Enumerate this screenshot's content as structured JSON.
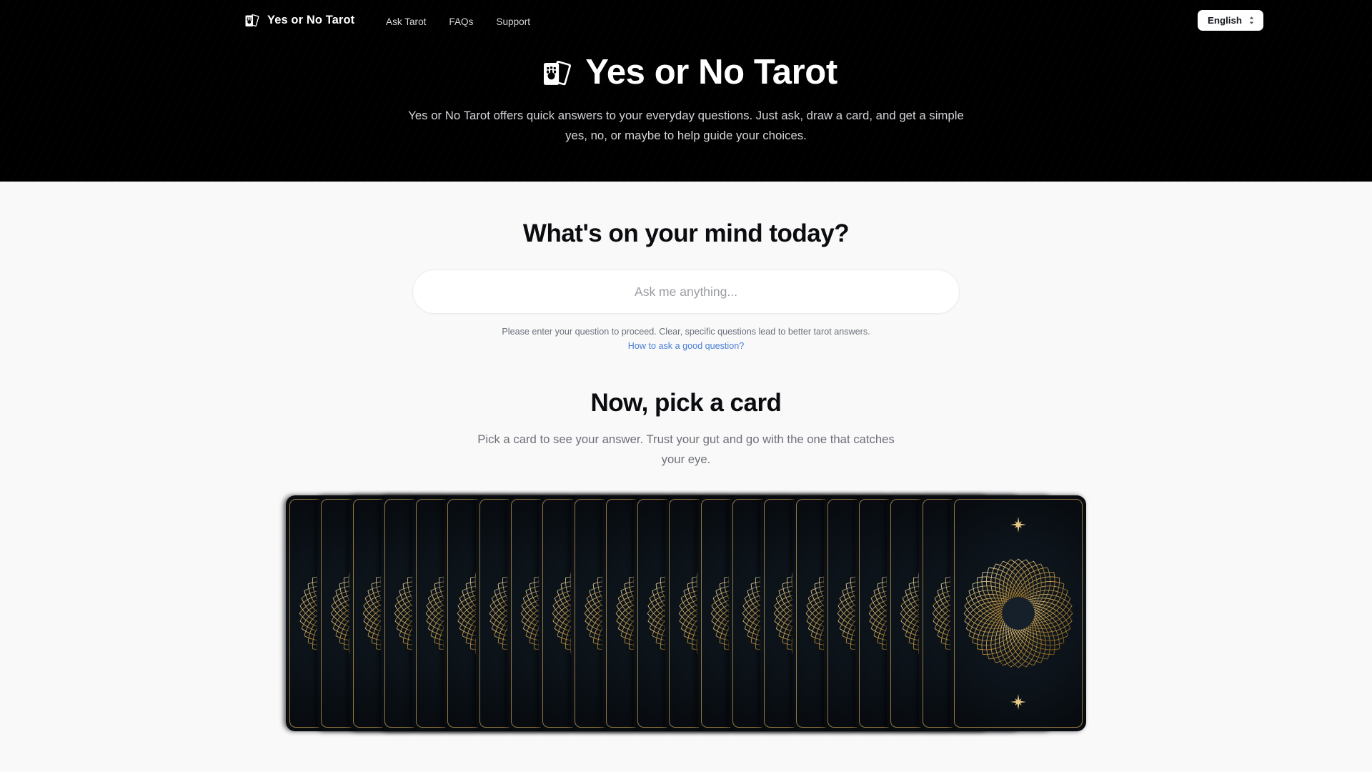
{
  "brand": {
    "name": "Yes or No Tarot",
    "logo_icon": "tarot-cards-icon"
  },
  "nav": {
    "links": [
      {
        "label": "Ask Tarot"
      },
      {
        "label": "FAQs"
      },
      {
        "label": "Support"
      }
    ],
    "language": {
      "selected": "English",
      "icon": "chevron-up-down-icon"
    }
  },
  "hero": {
    "title": "Yes or No Tarot",
    "logo_icon": "tarot-cards-icon",
    "subtitle": "Yes or No Tarot offers quick answers to your everyday questions. Just ask, draw a card, and get a simple yes, no, or maybe to help guide your choices."
  },
  "ask": {
    "heading": "What's on your mind today?",
    "input_value": "",
    "input_placeholder": "Ask me anything...",
    "helper_text": "Please enter your question to proceed. Clear, specific questions lead to better tarot answers.",
    "helper_link": "How to ask a good question?"
  },
  "pick": {
    "heading": "Now, pick a card",
    "subtitle": "Pick a card to see your answer. Trust your gut and go with the one that catches your eye.",
    "card_count": 22,
    "front_card_index": 21,
    "card_back_icons": [
      "sunburst-mandala-icon",
      "eight-point-star-icon"
    ]
  },
  "colors": {
    "hero_bg": "#000000",
    "page_bg": "#f9f9fa",
    "link_blue": "#4a7fd4",
    "card_gold": "#c8a354",
    "card_bg": "#0d151c",
    "muted_text": "#6d7077"
  }
}
